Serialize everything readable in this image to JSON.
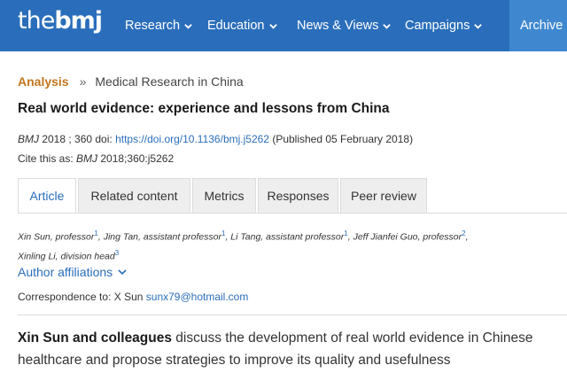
{
  "header": {
    "logo_the": "the",
    "logo_bmj": "bmj",
    "nav": [
      "Research",
      "Education",
      "News & Views",
      "Campaigns"
    ],
    "archive": "Archive"
  },
  "breadcrumb": {
    "section": "Analysis",
    "separator": "»",
    "topic": "Medical Research in China"
  },
  "article": {
    "title": "Real world evidence: experience and lessons from China",
    "journal": "BMJ",
    "year_vol": " 2018 ; 360  doi: ",
    "doi": "https://doi.org/10.1136/bmj.j5262",
    "published": " (Published 05 February 2018)",
    "cite_prefix": "Cite this as: ",
    "cite_journal": "BMJ",
    "cite_ref": "  2018;360:j5262"
  },
  "tabs": [
    "Article",
    "Related content",
    "Metrics",
    "Responses",
    "Peer review"
  ],
  "authors": [
    {
      "name": "Xin Sun, professor",
      "sup": "1"
    },
    {
      "name": "Jing Tan, assistant professor",
      "sup": "1"
    },
    {
      "name": "Li Tang, assistant professor",
      "sup": "1"
    },
    {
      "name": "Jeff Jianfei Guo, professor",
      "sup": "2"
    },
    {
      "name": "Xinling Li, division head",
      "sup": "3"
    }
  ],
  "affiliations_label": "Author affiliations",
  "correspondence": {
    "label": "Correspondence to: X Sun ",
    "email": "sunx79@hotmail.com"
  },
  "standfirst": {
    "lead": "Xin Sun and colleagues",
    "text": " discuss the development of real world evidence in Chinese healthcare and propose strategies to improve its quality and usefulness"
  },
  "colors": {
    "brand_blue": "#2a6ebb",
    "archive_blue": "#3f88d0",
    "section_orange": "#c2761c"
  }
}
